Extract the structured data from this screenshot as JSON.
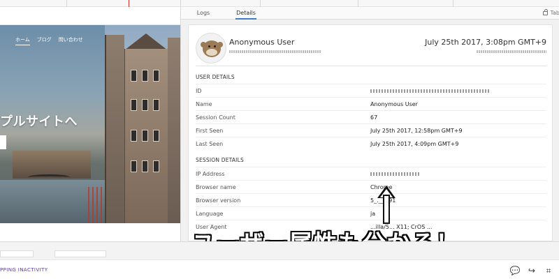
{
  "preview": {
    "nav": [
      "ホーム",
      "ブログ",
      "問い合わせ"
    ],
    "hero_text": "プルサイトへ"
  },
  "details_panel": {
    "tabs": [
      "Logs",
      "Details"
    ],
    "tab_right": "Tab",
    "user": {
      "name": "Anonymous User",
      "session_time": "July 25th 2017, 3:08pm GMT+9"
    },
    "user_details_title": "USER DETAILS",
    "user_details": [
      {
        "label": "ID",
        "value": ""
      },
      {
        "label": "Name",
        "value": "Anonymous User"
      },
      {
        "label": "Session Count",
        "value": "67"
      },
      {
        "label": "First Seen",
        "value": "July 25th 2017, 12:58pm GMT+9"
      },
      {
        "label": "Last Seen",
        "value": "July 25th 2017, 4:09pm GMT+9"
      }
    ],
    "session_details_title": "SESSION DETAILS",
    "session_details": [
      {
        "label": "IP Address",
        "value": ""
      },
      {
        "label": "Browser name",
        "value": "Chrome"
      },
      {
        "label": "Browser version",
        "value": "5_.___.91"
      },
      {
        "label": "Language",
        "value": "ja"
      },
      {
        "label": "User Agent",
        "value": "...illa/5... X11; CrOS ..."
      }
    ]
  },
  "annotation": {
    "text": "ユーザー属性も分かる！"
  },
  "status_bar": {
    "left_text": "PPING INACTIVITY",
    "icons": [
      "comments-icon",
      "share-icon",
      "crop-icon"
    ]
  },
  "colors": {
    "accent_blue": "#3c7ec9",
    "status_purple": "#5b3aa6"
  }
}
